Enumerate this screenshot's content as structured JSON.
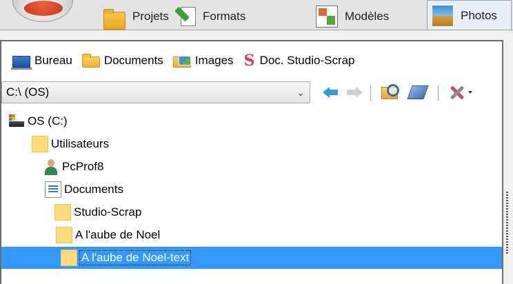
{
  "tabs": [
    {
      "label": "Projets",
      "icon": "projects-folder-icon"
    },
    {
      "label": "Formats",
      "icon": "formats-icon"
    },
    {
      "label": "Modèles",
      "icon": "templates-icon"
    },
    {
      "label": "Photos",
      "icon": "photos-icon",
      "active": true
    }
  ],
  "favorites": [
    {
      "label": "Bureau",
      "icon": "desktop-icon"
    },
    {
      "label": "Documents",
      "icon": "folder-icon"
    },
    {
      "label": "Images",
      "icon": "images-folder-icon"
    },
    {
      "label": "Doc. Studio-Scrap",
      "icon": "studio-scrap-icon"
    }
  ],
  "pathbar": {
    "value": "C:\\ (OS)"
  },
  "toolbar": [
    "back-arrow-icon",
    "forward-arrow-icon",
    "search-folder-icon",
    "send-icon",
    "tools-icon"
  ],
  "tree": [
    {
      "label": "OS (C:)",
      "icon": "drive-icon"
    },
    {
      "label": "Utilisateurs",
      "icon": "folder-icon"
    },
    {
      "label": "PcProf8",
      "icon": "user-icon"
    },
    {
      "label": "Documents",
      "icon": "documents-icon"
    },
    {
      "label": "Studio-Scrap",
      "icon": "folder-icon"
    },
    {
      "label": "A l'aube de Noel",
      "icon": "folder-icon"
    },
    {
      "label": "A l'aube de Noel-text",
      "icon": "folder-icon",
      "selected": true
    }
  ],
  "colors": {
    "selection": "#3399ff",
    "back_arrow": "#2f9bd8",
    "studio_scrap_logo": "#d93b52"
  }
}
